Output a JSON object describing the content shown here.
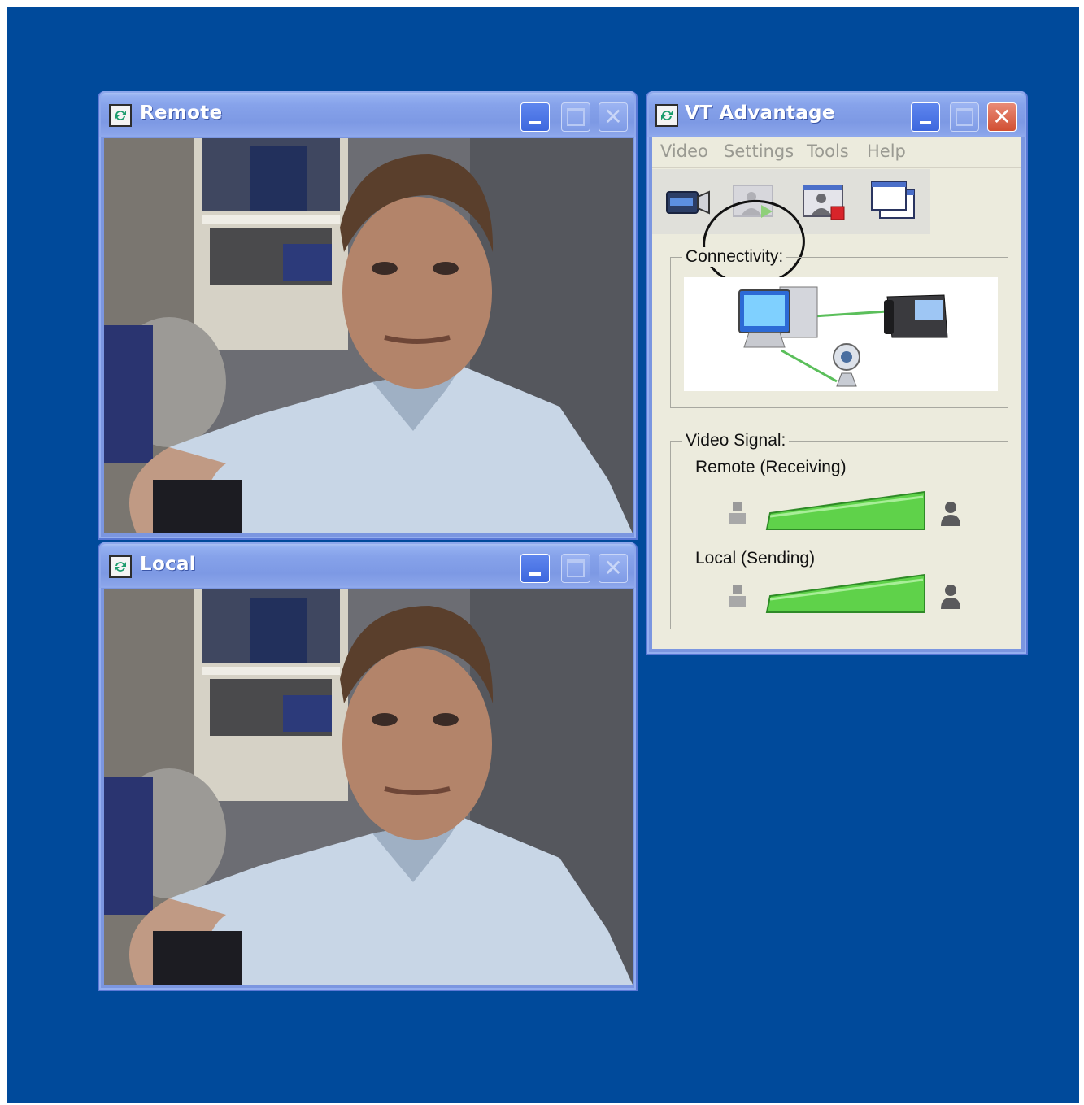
{
  "remote_window": {
    "title": "Remote",
    "icon": "app-sync-icon"
  },
  "local_window": {
    "title": "Local",
    "icon": "app-sync-icon"
  },
  "vt_window": {
    "title": "VT Advantage",
    "icon": "app-sync-icon",
    "menu": [
      "Video",
      "Settings",
      "Tools",
      "Help"
    ],
    "toolbar": [
      "camera-icon",
      "start-video-icon",
      "stop-video-icon",
      "windows-icon"
    ],
    "connectivity_label": "Connectivity:",
    "connectivity_icons": [
      "computer-icon",
      "ip-phone-icon",
      "webcam-icon"
    ],
    "video_signal_label": "Video Signal:",
    "remote_label": "Remote (Receiving)",
    "local_label": "Local (Sending)",
    "remote_signal_level": 1.0,
    "local_signal_level": 1.0
  },
  "colors": {
    "desktop": "#004a9b",
    "title_bar": "#86a2ea",
    "signal_green": "#5fd24a",
    "window_face": "#ecebdd"
  }
}
